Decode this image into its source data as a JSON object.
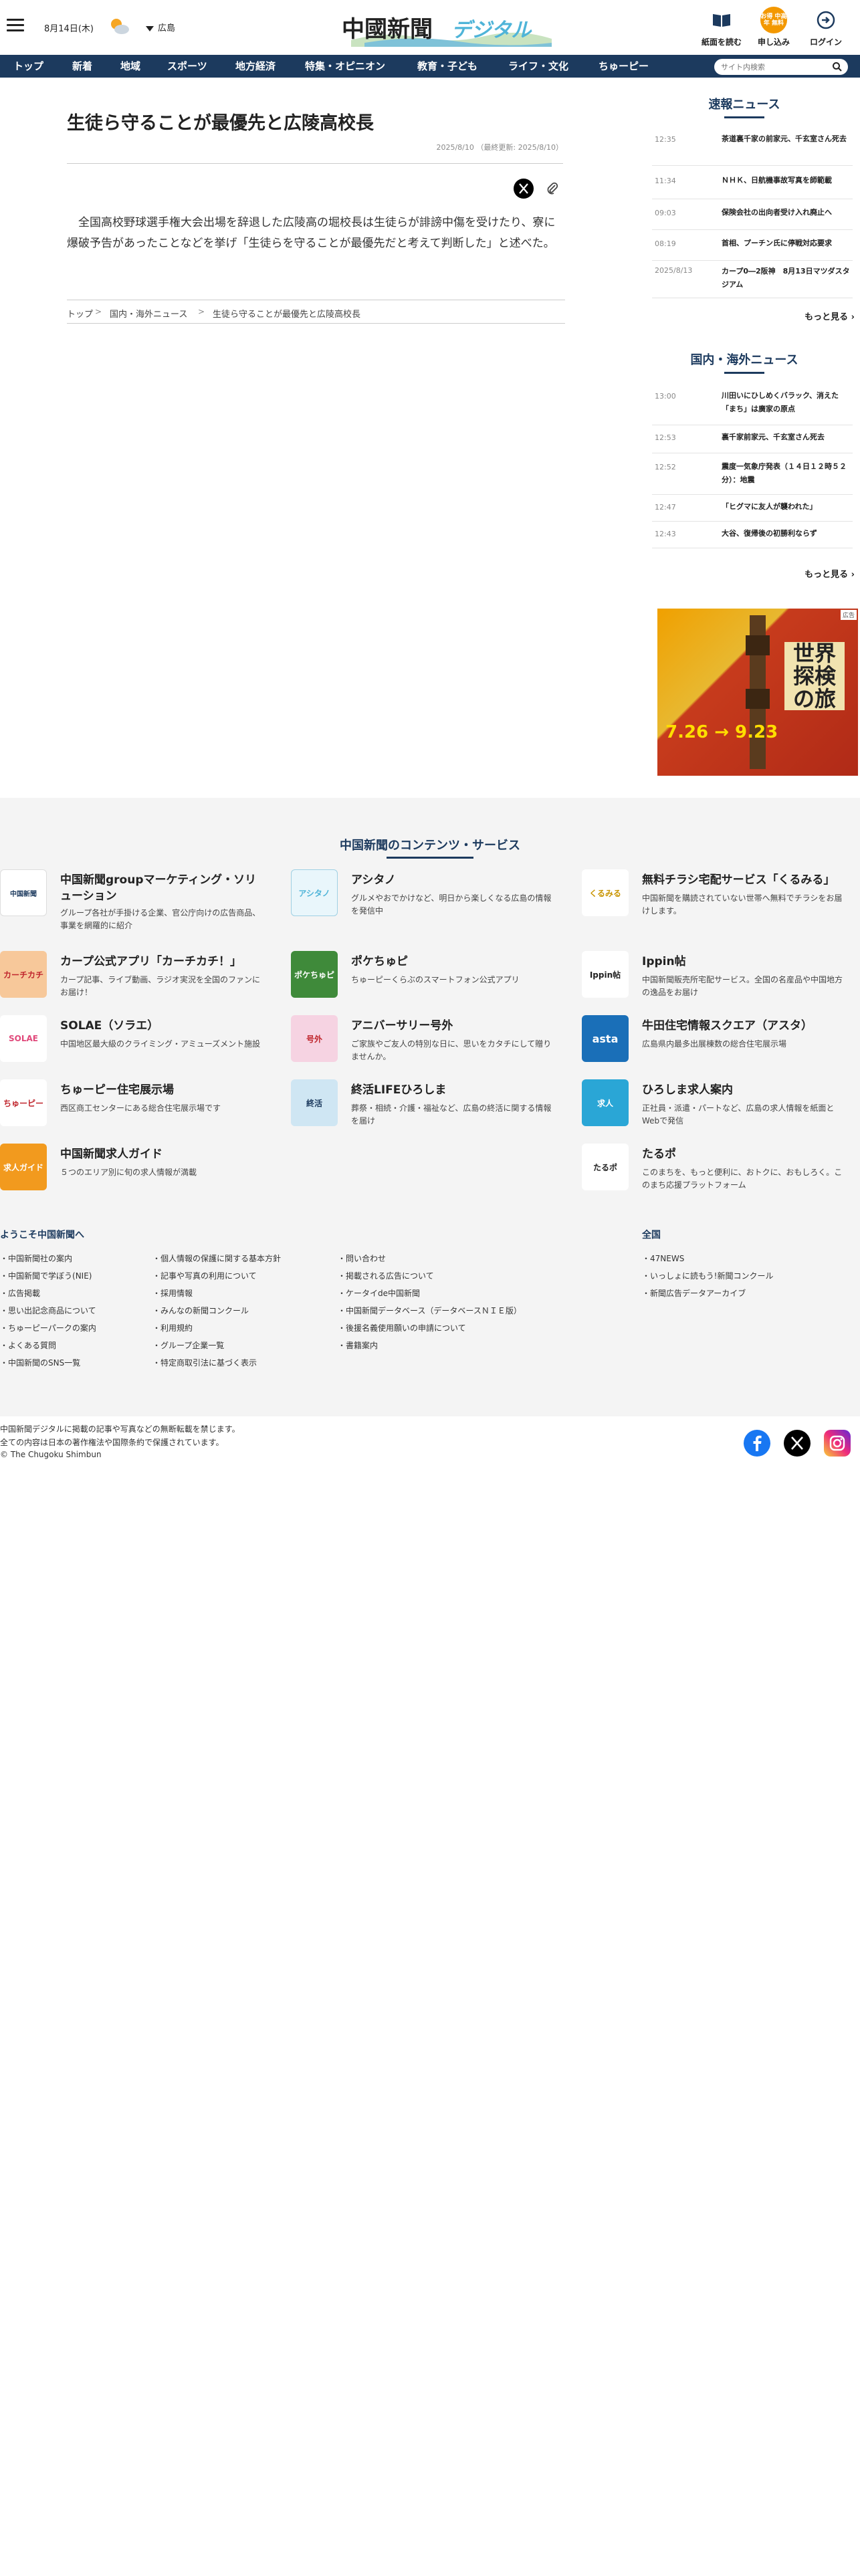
{
  "header": {
    "date": "8月14日(木)",
    "region": "広島",
    "logo_text": "中國新聞",
    "logo_sub": "デジタル",
    "buttons": [
      "紙面を読む",
      "申し込み",
      "ログイン"
    ],
    "apply_badge": "お得 中高年 無料"
  },
  "nav": {
    "items": [
      "トップ",
      "新着",
      "地域",
      "スポーツ",
      "地方経済",
      "特集・オピニオン",
      "教育・子ども",
      "ライフ・文化",
      "ちゅーピー"
    ],
    "search_placeholder": "サイト内検索"
  },
  "article": {
    "title": "生徒ら守ることが最優先と広陵高校長",
    "date": "2025/8/10 （最終更新: 2025/8/10）",
    "body": "全国高校野球選手権大会出場を辞退した広陵高の堀校長は生徒らが誹謗中傷を受けたり、寮に爆破予告があったことなどを挙げ「生徒らを守ることが最優先だと考えて判断した」と述べた。",
    "breadcrumb": [
      "トップ",
      "国内・海外ニュース",
      "生徒ら守ることが最優先と広陵高校長"
    ]
  },
  "sidebar": {
    "breaking": {
      "title": "速報ニュース",
      "items": [
        {
          "time": "12:35",
          "text": "茶道裏千家の前家元、千玄室さん死去"
        },
        {
          "time": "11:34",
          "text": "ＮＨＫ、日航機事故写真を師範載"
        },
        {
          "time": "09:03",
          "text": "保険会社の出向者受け入れ廃止へ"
        },
        {
          "time": "08:19",
          "text": "首相、プーチン氏に停戦対応要求"
        },
        {
          "time": "2025/8/13",
          "text": "カープ0―2阪神　8月13日マツダスタジアム"
        }
      ],
      "more": "もっと見る"
    },
    "domestic": {
      "title": "国内・海外ニュース",
      "items": [
        {
          "time": "13:00",
          "text": "川田いにひしめくバラック、消えた「まち」は廣家の原点"
        },
        {
          "time": "12:53",
          "text": "裏千家前家元、千玄室さん死去"
        },
        {
          "time": "12:52",
          "text": "震度一気象庁発表（１４日１２時５２分）：地震"
        },
        {
          "time": "12:47",
          "text": "「ヒグマに友人が襲われた」"
        },
        {
          "time": "12:43",
          "text": "大谷、復帰後の初勝利ならず"
        }
      ],
      "more": "もっと見る"
    },
    "ad": {
      "badge": "広告",
      "title": "世界探検の旅",
      "date": "7.26 → 9.23"
    }
  },
  "services": {
    "title": "中国新聞のコンテンツ・サービス",
    "items": [
      {
        "name": "中国新聞groupマーケティング・ソリューション",
        "desc": "グループ各社が手掛ける企業、官公庁向けの広告商品、事業を網羅的に紹介",
        "thumb": "中国新聞",
        "color": "#ffffff"
      },
      {
        "name": "アシタノ",
        "desc": "グルメやおでかけなど、明日から楽しくなる広島の情報を発信中",
        "thumb": "アシタノ",
        "color": "#e9f6fb"
      },
      {
        "name": "無料チラシ宅配サービス「くるみる」",
        "desc": "中国新聞を購読されていない世帯へ無料でチラシをお届けします。",
        "thumb": "くるみる",
        "color": "#ffffff"
      },
      {
        "name": "カープ公式アプリ「カーチカチ！」",
        "desc": "カープ記事、ライブ動画、ラジオ実況を全国のファンにお届け！",
        "thumb": "カーチカチ",
        "color": "#f7c89a"
      },
      {
        "name": "ポケちゅピ",
        "desc": "ちゅーピーくらぶのスマートフォン公式アプリ",
        "thumb": "ポケちゅピ",
        "color": "#3f8a3a"
      },
      {
        "name": "Ippin帖",
        "desc": "中国新聞販売所宅配サービス。全国の名産品や中国地方の逸品をお届け",
        "thumb": "Ippin帖",
        "color": "#ffffff"
      },
      {
        "name": "SOLAE（ソラエ）",
        "desc": "中国地区最大級のクライミング・アミューズメント施設",
        "thumb": "SOLAE",
        "color": "#ffffff"
      },
      {
        "name": "アニバーサリー号外",
        "desc": "ご家族やご友人の特別な日に、思いをカタチにして贈りませんか。",
        "thumb": "号外",
        "color": "#f6d3e2"
      },
      {
        "name": "牛田住宅情報スクエア（アスタ）",
        "desc": "広島県内最多出展棟数の総合住宅展示場",
        "thumb": "asta",
        "color": "#1a6fb8"
      },
      {
        "name": "ちゅーピー住宅展示場",
        "desc": "西区商工センターにある総合住宅展示場です",
        "thumb": "ちゅーピー",
        "color": "#ffffff"
      },
      {
        "name": "終活LIFEひろしま",
        "desc": "葬祭・相続・介護・福祉など、広島の終活に関する情報を届け",
        "thumb": "終活",
        "color": "#cfe6f3"
      },
      {
        "name": "ひろしま求人案内",
        "desc": "正社員・派遣・パートなど、広島の求人情報を紙面とWebで発信",
        "thumb": "求人",
        "color": "#2aa6d6"
      },
      {
        "name": "中国新聞求人ガイド",
        "desc": "５つのエリア別に旬の求人情報が満載",
        "thumb": "求人ガイド",
        "color": "#f29a1e"
      },
      {
        "name": "たるポ",
        "desc": "このまちを、もっと便利に、おトクに、おもしろく。このまち応援プラットフォーム",
        "thumb": "たるポ",
        "color": "#ffffff"
      }
    ]
  },
  "footer": {
    "welcome_title": "ようこそ中国新聞へ",
    "col1": [
      "中国新聞社の案内",
      "中国新聞で学ぼう(NIE)",
      "広告掲載",
      "思い出記念商品について",
      "ちゅーピーパークの案内",
      "よくある質問",
      "中国新聞のSNS一覧"
    ],
    "col2": [
      "個人情報の保護に関する基本方針",
      "記事や写真の利用について",
      "採用情報",
      "みんなの新聞コンクール",
      "利用規約",
      "グループ企業一覧",
      "特定商取引法に基づく表示"
    ],
    "col3": [
      "問い合わせ",
      "掲載される広告について",
      "ケータイde中国新聞",
      "中国新聞データベース（データベースＮＩＥ版）",
      "後援名義使用願いの申請について",
      "書籍案内"
    ],
    "national_title": "全国",
    "national": [
      "47NEWS",
      "いっしょに読もう!新聞コンクール",
      "新聞広告データアーカイブ"
    ],
    "copyright": [
      "中国新聞デジタルに掲載の記事や写真などの無断転載を禁じます。",
      "全ての内容は日本の著作権法や国際条約で保護されています。",
      "© The Chugoku Shimbun"
    ]
  }
}
